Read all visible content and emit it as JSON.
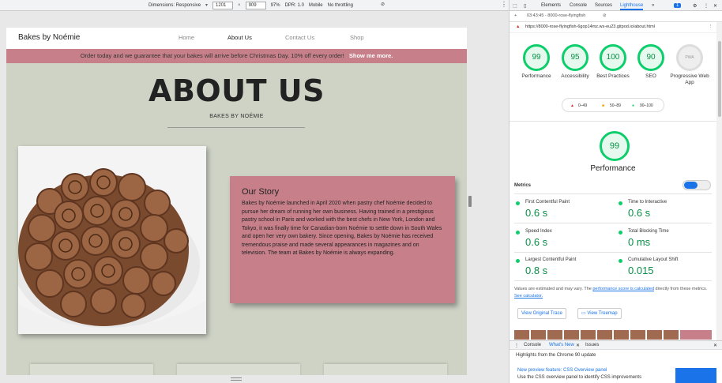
{
  "devtools_toolbar": {
    "dimensions_label": "Dimensions: Responsive",
    "width": "1201",
    "times": "×",
    "height": "909",
    "zoom": "97%",
    "dpr": "DPR: 1.0",
    "device": "Mobile",
    "throttle": "No throttling"
  },
  "site": {
    "brand": "Bakes by Noémie",
    "nav": [
      "Home",
      "About Us",
      "Contact Us",
      "Shop"
    ],
    "promo_text": "Order today and we guarantee that your bakes will arrive before Christmas Day. 10% off every order!",
    "promo_link": "Show me more.",
    "title": "ABOUT US",
    "subtitle": "BAKES BY NOÉMIE",
    "story_heading": "Our Story",
    "story_text": "Bakes by Noémie launched in April 2020 when pastry chef Noémie decided to pursue her dream of running her own business. Having trained in a prestigious pastry school in Paris and worked with the best chefs in New York, London and Tokyo, it was finally time for Canadian-born Noémie to settle down in South Wales and open her very own bakery. Since opening, Bakes by Noémie has received tremendous praise and made several appearances in magazines and on television. The team at Bakes by Noémie is always expanding."
  },
  "devtools": {
    "tabs": [
      "Elements",
      "Console",
      "Sources",
      "Lighthouse"
    ],
    "more": "»",
    "issues_count": "1",
    "report_label": "03:43:45 - 8000-rose-flyingfish",
    "url": "https://8000-rose-flyingfish-6gop14mz.ws-eu23.gitpod.io/about.html",
    "scores": [
      {
        "value": "99",
        "label": "Performance"
      },
      {
        "value": "95",
        "label": "Accessibility"
      },
      {
        "value": "100",
        "label": "Best Practices"
      },
      {
        "value": "90",
        "label": "SEO"
      },
      {
        "value": "PWA",
        "label": "Progressive Web App"
      }
    ],
    "legend": [
      "0–49",
      "50–89",
      "90–100"
    ],
    "perf_score": "99",
    "perf_label": "Performance",
    "metrics_heading": "Metrics",
    "metrics": [
      {
        "name": "First Contentful Paint",
        "value": "0.6 s"
      },
      {
        "name": "Time to Interactive",
        "value": "0.6 s"
      },
      {
        "name": "Speed Index",
        "value": "0.6 s"
      },
      {
        "name": "Total Blocking Time",
        "value": "0 ms"
      },
      {
        "name": "Largest Contentful Paint",
        "value": "0.8 s"
      },
      {
        "name": "Cumulative Layout Shift",
        "value": "0.015"
      }
    ],
    "note_pre": "Values are estimated and may vary. The",
    "note_link": "performance score is calculated",
    "note_post": "directly from these metrics.",
    "note_link2": "See calculator.",
    "btn_trace": "View Original Trace",
    "btn_treemap": "View Treemap",
    "drawer_tabs": [
      "Console",
      "What's New",
      "Issues"
    ],
    "drawer_heading": "Highlights from the Chrome 90 update",
    "update_title": "New preview feature: CSS Overview panel",
    "update_desc": "Use the CSS overview panel to identify CSS improvements"
  },
  "colors": {
    "page_bg": "#ced3c6",
    "accent_pink": "#c7808a",
    "score_green": "#0cce6b",
    "link_blue": "#1a73e8"
  }
}
